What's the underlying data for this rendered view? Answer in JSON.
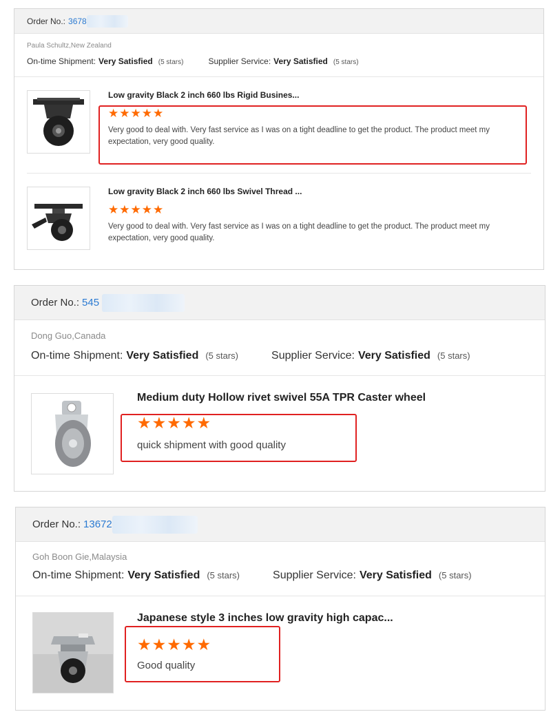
{
  "orders": [
    {
      "order_label": "Order No.:",
      "order_number": "3678",
      "buyer": "Paula Schultz,New Zealand",
      "shipment_label": "On-time Shipment:",
      "shipment_value": "Very Satisfied",
      "shipment_stars": "(5 stars)",
      "service_label": "Supplier Service:",
      "service_value": "Very Satisfied",
      "service_stars": "(5 stars)",
      "items": [
        {
          "name": "Low gravity Black 2 inch 660 lbs Rigid Busines...",
          "stars": "★★★★★",
          "rating": 5,
          "review": "Very good to deal with. Very fast service as I was on a tight deadline to get the product. The product meet my expectation, very good quality."
        },
        {
          "name": "Low gravity Black 2 inch 660 lbs Swivel Thread ...",
          "stars": "★★★★★",
          "rating": 5,
          "review": "Very good to deal with. Very fast service as I was on a tight deadline to get the product. The product meet my expectation, very good quality."
        }
      ]
    },
    {
      "order_label": "Order No.:",
      "order_number": "545",
      "buyer": "Dong Guo,Canada",
      "shipment_label": "On-time Shipment:",
      "shipment_value": "Very Satisfied",
      "shipment_stars": "(5 stars)",
      "service_label": "Supplier Service:",
      "service_value": "Very Satisfied",
      "service_stars": "(5 stars)",
      "items": [
        {
          "name": "Medium duty Hollow rivet swivel 55A TPR Caster wheel",
          "stars": "★★★★★",
          "rating": 5,
          "review": "quick shipment with good quality"
        }
      ]
    },
    {
      "order_label": "Order No.:",
      "order_number": "13672",
      "buyer": "Goh Boon Gie,Malaysia",
      "shipment_label": "On-time Shipment:",
      "shipment_value": "Very Satisfied",
      "shipment_stars": "(5 stars)",
      "service_label": "Supplier Service:",
      "service_value": "Very Satisfied",
      "service_stars": "(5 stars)",
      "items": [
        {
          "name": "Japanese style 3 inches low gravity high capac...",
          "stars": "★★★★★",
          "rating": 5,
          "review": "Good quality"
        }
      ]
    }
  ],
  "colors": {
    "order_link": "#2a7ad2",
    "star": "#ff6a00",
    "highlight_box": "#e02020",
    "header_bg": "#f2f2f2"
  }
}
